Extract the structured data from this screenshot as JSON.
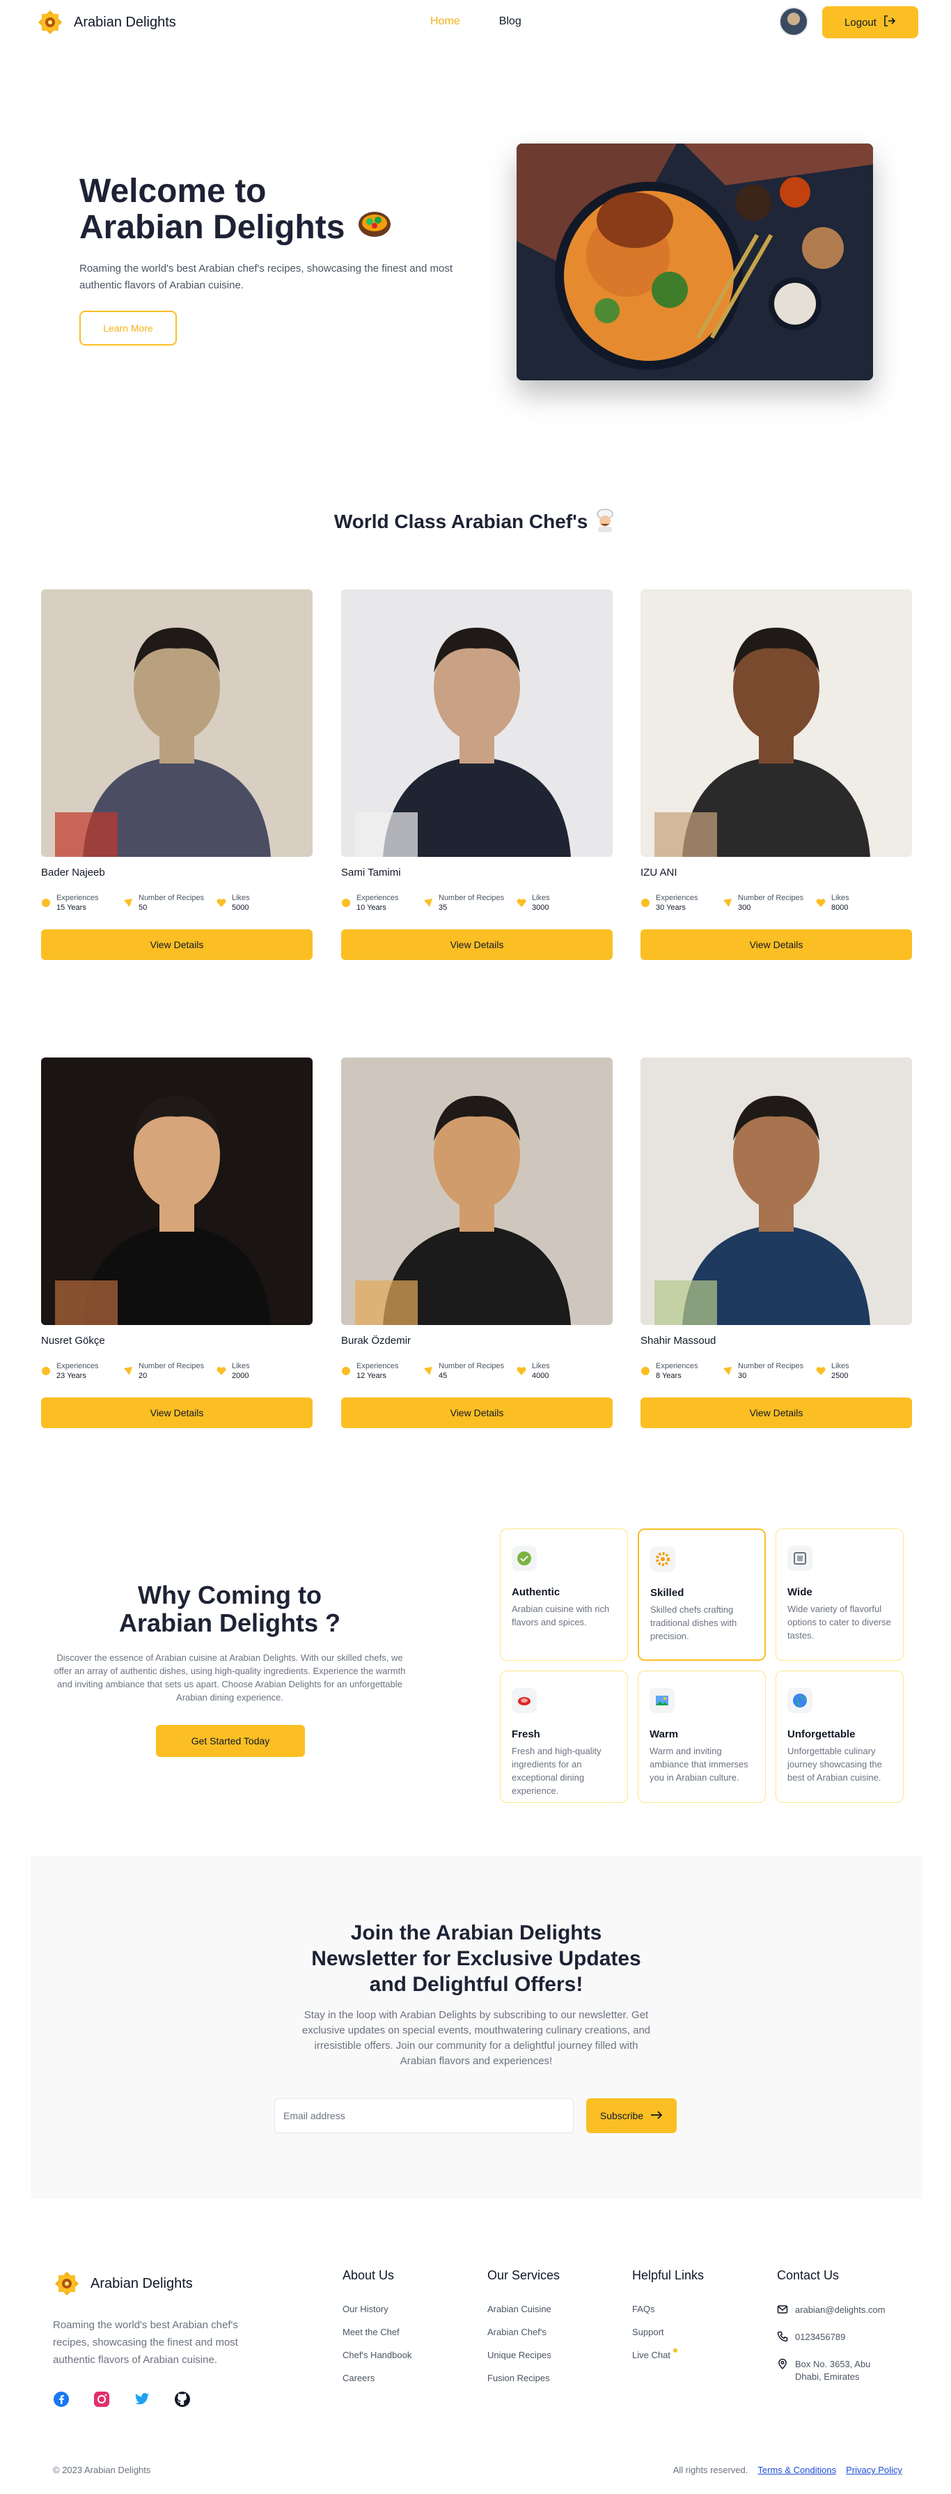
{
  "nav": {
    "brand": "Arabian Delights",
    "links": [
      "Home",
      "Blog"
    ],
    "logout_label": "Logout"
  },
  "hero": {
    "title_line1": "Welcome to",
    "title_line2": "Arabian Delights",
    "subtitle": "Roaming the world's best Arabian chef's recipes, showcasing the finest and most authentic flavors of Arabian cuisine.",
    "cta": "Learn More"
  },
  "chefs_section": {
    "title": "World Class Arabian Chef's",
    "stat_labels": {
      "experience": "Experiences",
      "recipes": "Number of Recipes",
      "likes": "Likes"
    },
    "button_label": "View Details",
    "chefs": [
      {
        "name": "Bader Najeeb",
        "experience": "15 Years",
        "recipes": "50",
        "likes": "5000"
      },
      {
        "name": "Sami Tamimi",
        "experience": "10 Years",
        "recipes": "35",
        "likes": "3000"
      },
      {
        "name": "IZU ANI",
        "experience": "30 Years",
        "recipes": "300",
        "likes": "8000"
      },
      {
        "name": "Nusret Gökçe",
        "experience": "23 Years",
        "recipes": "20",
        "likes": "2000"
      },
      {
        "name": "Burak Özdemir",
        "experience": "12 Years",
        "recipes": "45",
        "likes": "4000"
      },
      {
        "name": "Shahir Massoud",
        "experience": "8 Years",
        "recipes": "30",
        "likes": "2500"
      }
    ]
  },
  "why": {
    "title_line1": "Why Coming to",
    "title_line2": "Arabian Delights ?",
    "text": "Discover the essence of Arabian cuisine at Arabian Delights. With our skilled chefs, we offer an array of authentic dishes, using high-quality ingredients. Experience the warmth and inviting ambiance that sets us apart. Choose Arabian Delights for an unforgettable Arabian dining experience.",
    "cta": "Get Started Today",
    "features": [
      {
        "title": "Authentic",
        "text": "Arabian cuisine with rich flavors and spices.",
        "icon": "check-badge-icon"
      },
      {
        "title": "Skilled",
        "text": "Skilled chefs crafting traditional dishes with precision.",
        "icon": "gear-icon"
      },
      {
        "title": "Wide",
        "text": "Wide variety of flavorful options to cater to diverse tastes.",
        "icon": "film-frame-icon"
      },
      {
        "title": "Fresh",
        "text": "Fresh and high-quality ingredients for an exceptional dining experience.",
        "icon": "meat-icon"
      },
      {
        "title": "Warm",
        "text": "Warm and inviting ambiance that immerses you in Arabian culture.",
        "icon": "picture-icon"
      },
      {
        "title": "Unforgettable",
        "text": "Unforgettable culinary journey showcasing the best of Arabian cuisine.",
        "icon": "globe-icon"
      }
    ]
  },
  "newsletter": {
    "title_line1": "Join the Arabian Delights",
    "title_line2": "Newsletter for Exclusive Updates",
    "title_line3": "and Delightful Offers!",
    "text": "Stay in the loop with Arabian Delights by subscribing to our newsletter. Get exclusive updates on special events, mouthwatering culinary creations, and irresistible offers. Join our community for a delightful journey filled with Arabian flavors and experiences!",
    "placeholder": "Email address",
    "button": "Subscribe"
  },
  "footer": {
    "brand": "Arabian Delights",
    "description": "Roaming the world's best Arabian chef's recipes, showcasing the finest and most authentic flavors of Arabian cuisine.",
    "about": {
      "title": "About Us",
      "links": [
        "Our History",
        "Meet the Chef",
        "Chef's Handbook",
        "Careers"
      ]
    },
    "services": {
      "title": "Our Services",
      "links": [
        "Arabian Cuisine",
        "Arabian Chef's",
        "Unique Recipes",
        "Fusion Recipes"
      ]
    },
    "help": {
      "title": "Helpful Links",
      "links": [
        "FAQs",
        "Support",
        "Live Chat"
      ]
    },
    "contact": {
      "title": "Contact Us",
      "email": "arabian@delights.com",
      "phone": "0123456789",
      "address_line1": "Box No. 3653, Abu",
      "address_line2": "Dhabi, Emirates"
    },
    "copyright": "© 2023 Arabian Delights",
    "rights": "All rights reserved.",
    "terms": "Terms & Conditions",
    "privacy": "Privacy Policy"
  },
  "colors": {
    "accent": "#fbbf24",
    "heading": "#1e2235",
    "muted": "#6b7280"
  }
}
